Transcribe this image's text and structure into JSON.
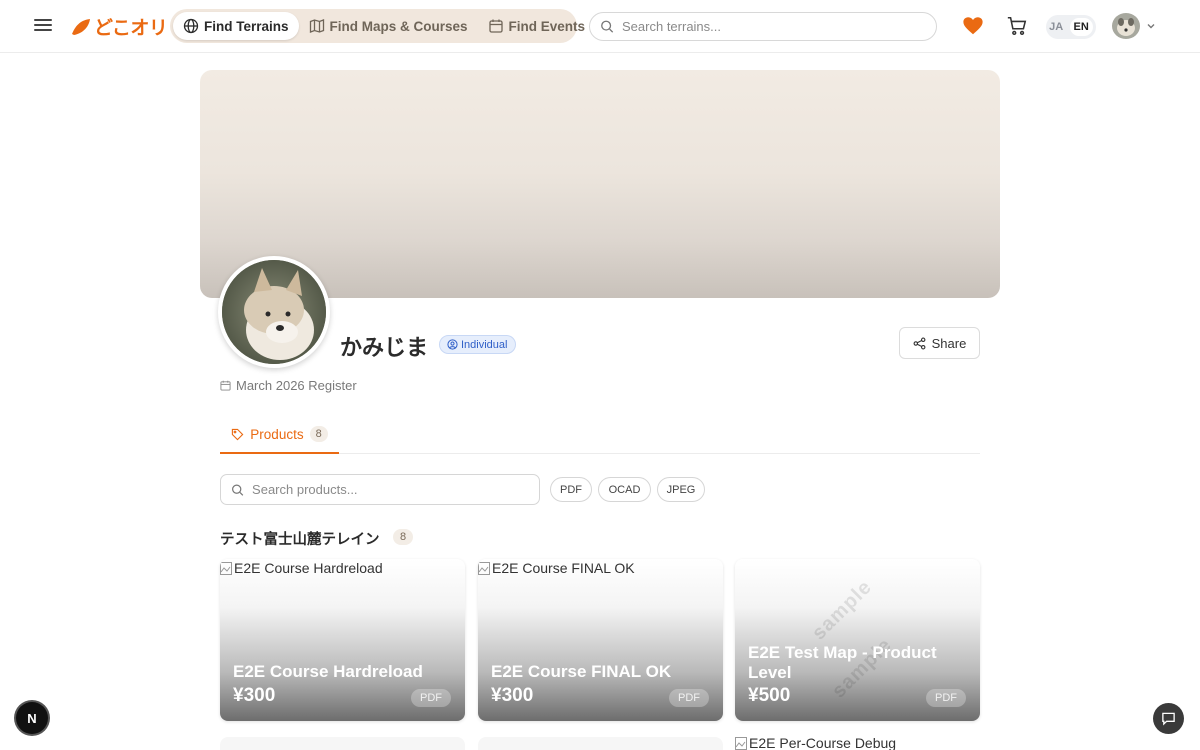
{
  "header": {
    "logo_text": "どこオリ",
    "nav": [
      {
        "label": "Find Terrains",
        "icon": "globe-icon",
        "active": true
      },
      {
        "label": "Find Maps & Courses",
        "icon": "map-icon",
        "active": false
      },
      {
        "label": "Find Events",
        "icon": "calendar-icon",
        "active": false
      }
    ],
    "search_placeholder": "Search terrains...",
    "lang_ja": "JA",
    "lang_en": "EN",
    "accent": "#ea6a12"
  },
  "profile": {
    "name": "かみじま",
    "badge": "Individual",
    "share_label": "Share",
    "register": "March 2026 Register"
  },
  "tabs": {
    "products_label": "Products",
    "products_count": "8"
  },
  "filters": {
    "search_placeholder": "Search products...",
    "formats": [
      "PDF",
      "OCAD",
      "JPEG"
    ]
  },
  "section": {
    "title": "テスト富士山麓テレイン",
    "count": "8"
  },
  "products": [
    {
      "alt": "E2E Course Hardreload",
      "title": "E2E Course Hardreload",
      "price": "¥300",
      "format": "PDF"
    },
    {
      "alt": "E2E Course FINAL OK",
      "title": "E2E Course FINAL OK",
      "price": "¥300",
      "format": "PDF"
    },
    {
      "alt": "",
      "title": "E2E Test Map - Product Level",
      "price": "¥500",
      "format": "PDF",
      "watermark": "sample"
    }
  ],
  "next_row": [
    {
      "alt": "E2E Per-Course Debug"
    }
  ],
  "floating": {
    "dev_label": "N"
  }
}
